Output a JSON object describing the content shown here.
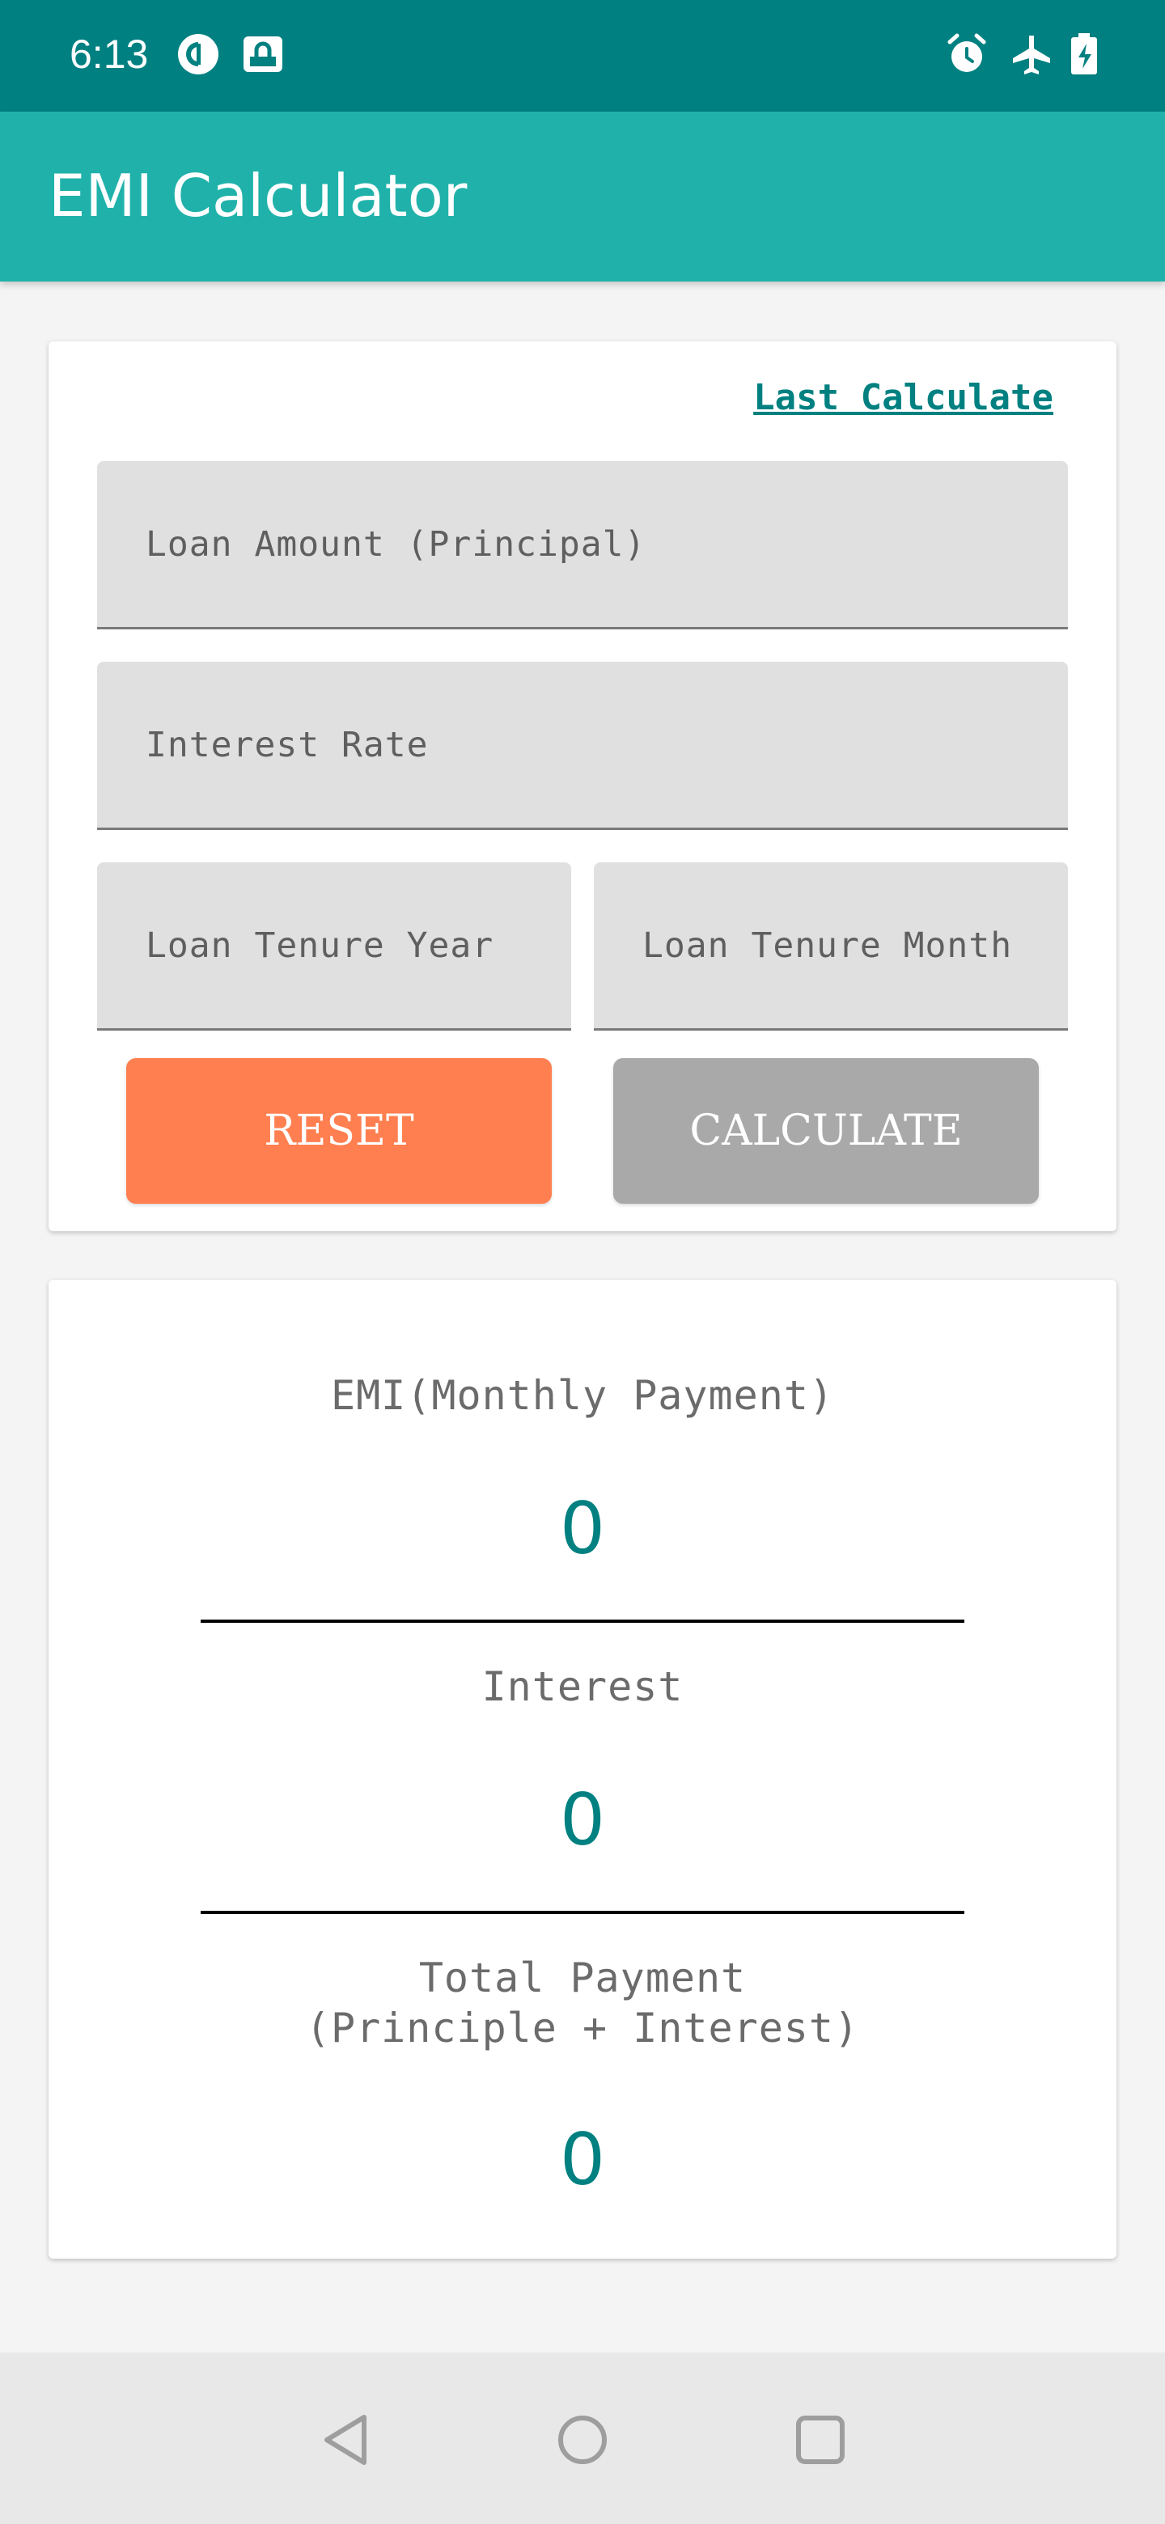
{
  "status_bar": {
    "time": "6:13",
    "left_icons": [
      "pocket-casts-icon",
      "lock-screen-icon"
    ],
    "right_icons": [
      "alarm-icon",
      "airplane-icon",
      "battery-charging-icon"
    ]
  },
  "app_bar": {
    "title": "EMI Calculator"
  },
  "form": {
    "last_calculate_link": "Last Calculate",
    "principal": {
      "placeholder": "Loan Amount (Principal)",
      "value": ""
    },
    "interest_rate": {
      "placeholder": "Interest Rate",
      "value": ""
    },
    "tenure_year": {
      "placeholder": "Loan Tenure Year",
      "value": ""
    },
    "tenure_month": {
      "placeholder": "Loan Tenure Month",
      "value": ""
    },
    "reset_label": "RESET",
    "calculate_label": "CALCULATE"
  },
  "results": {
    "emi_label": "EMI(Monthly Payment)",
    "emi_value": "0",
    "interest_label": "Interest",
    "interest_value": "0",
    "total_label_line1": "Total Payment",
    "total_label_line2": "(Principle + Interest)",
    "total_value": "0"
  },
  "nav_bar": {
    "icons": [
      "back-icon",
      "home-icon",
      "recents-icon"
    ]
  },
  "colors": {
    "status_bar": "#008080",
    "app_bar": "#20B2AA",
    "accent_text": "#008080",
    "reset_button": "#FF7F50",
    "calculate_button": "#A9A9A9"
  }
}
